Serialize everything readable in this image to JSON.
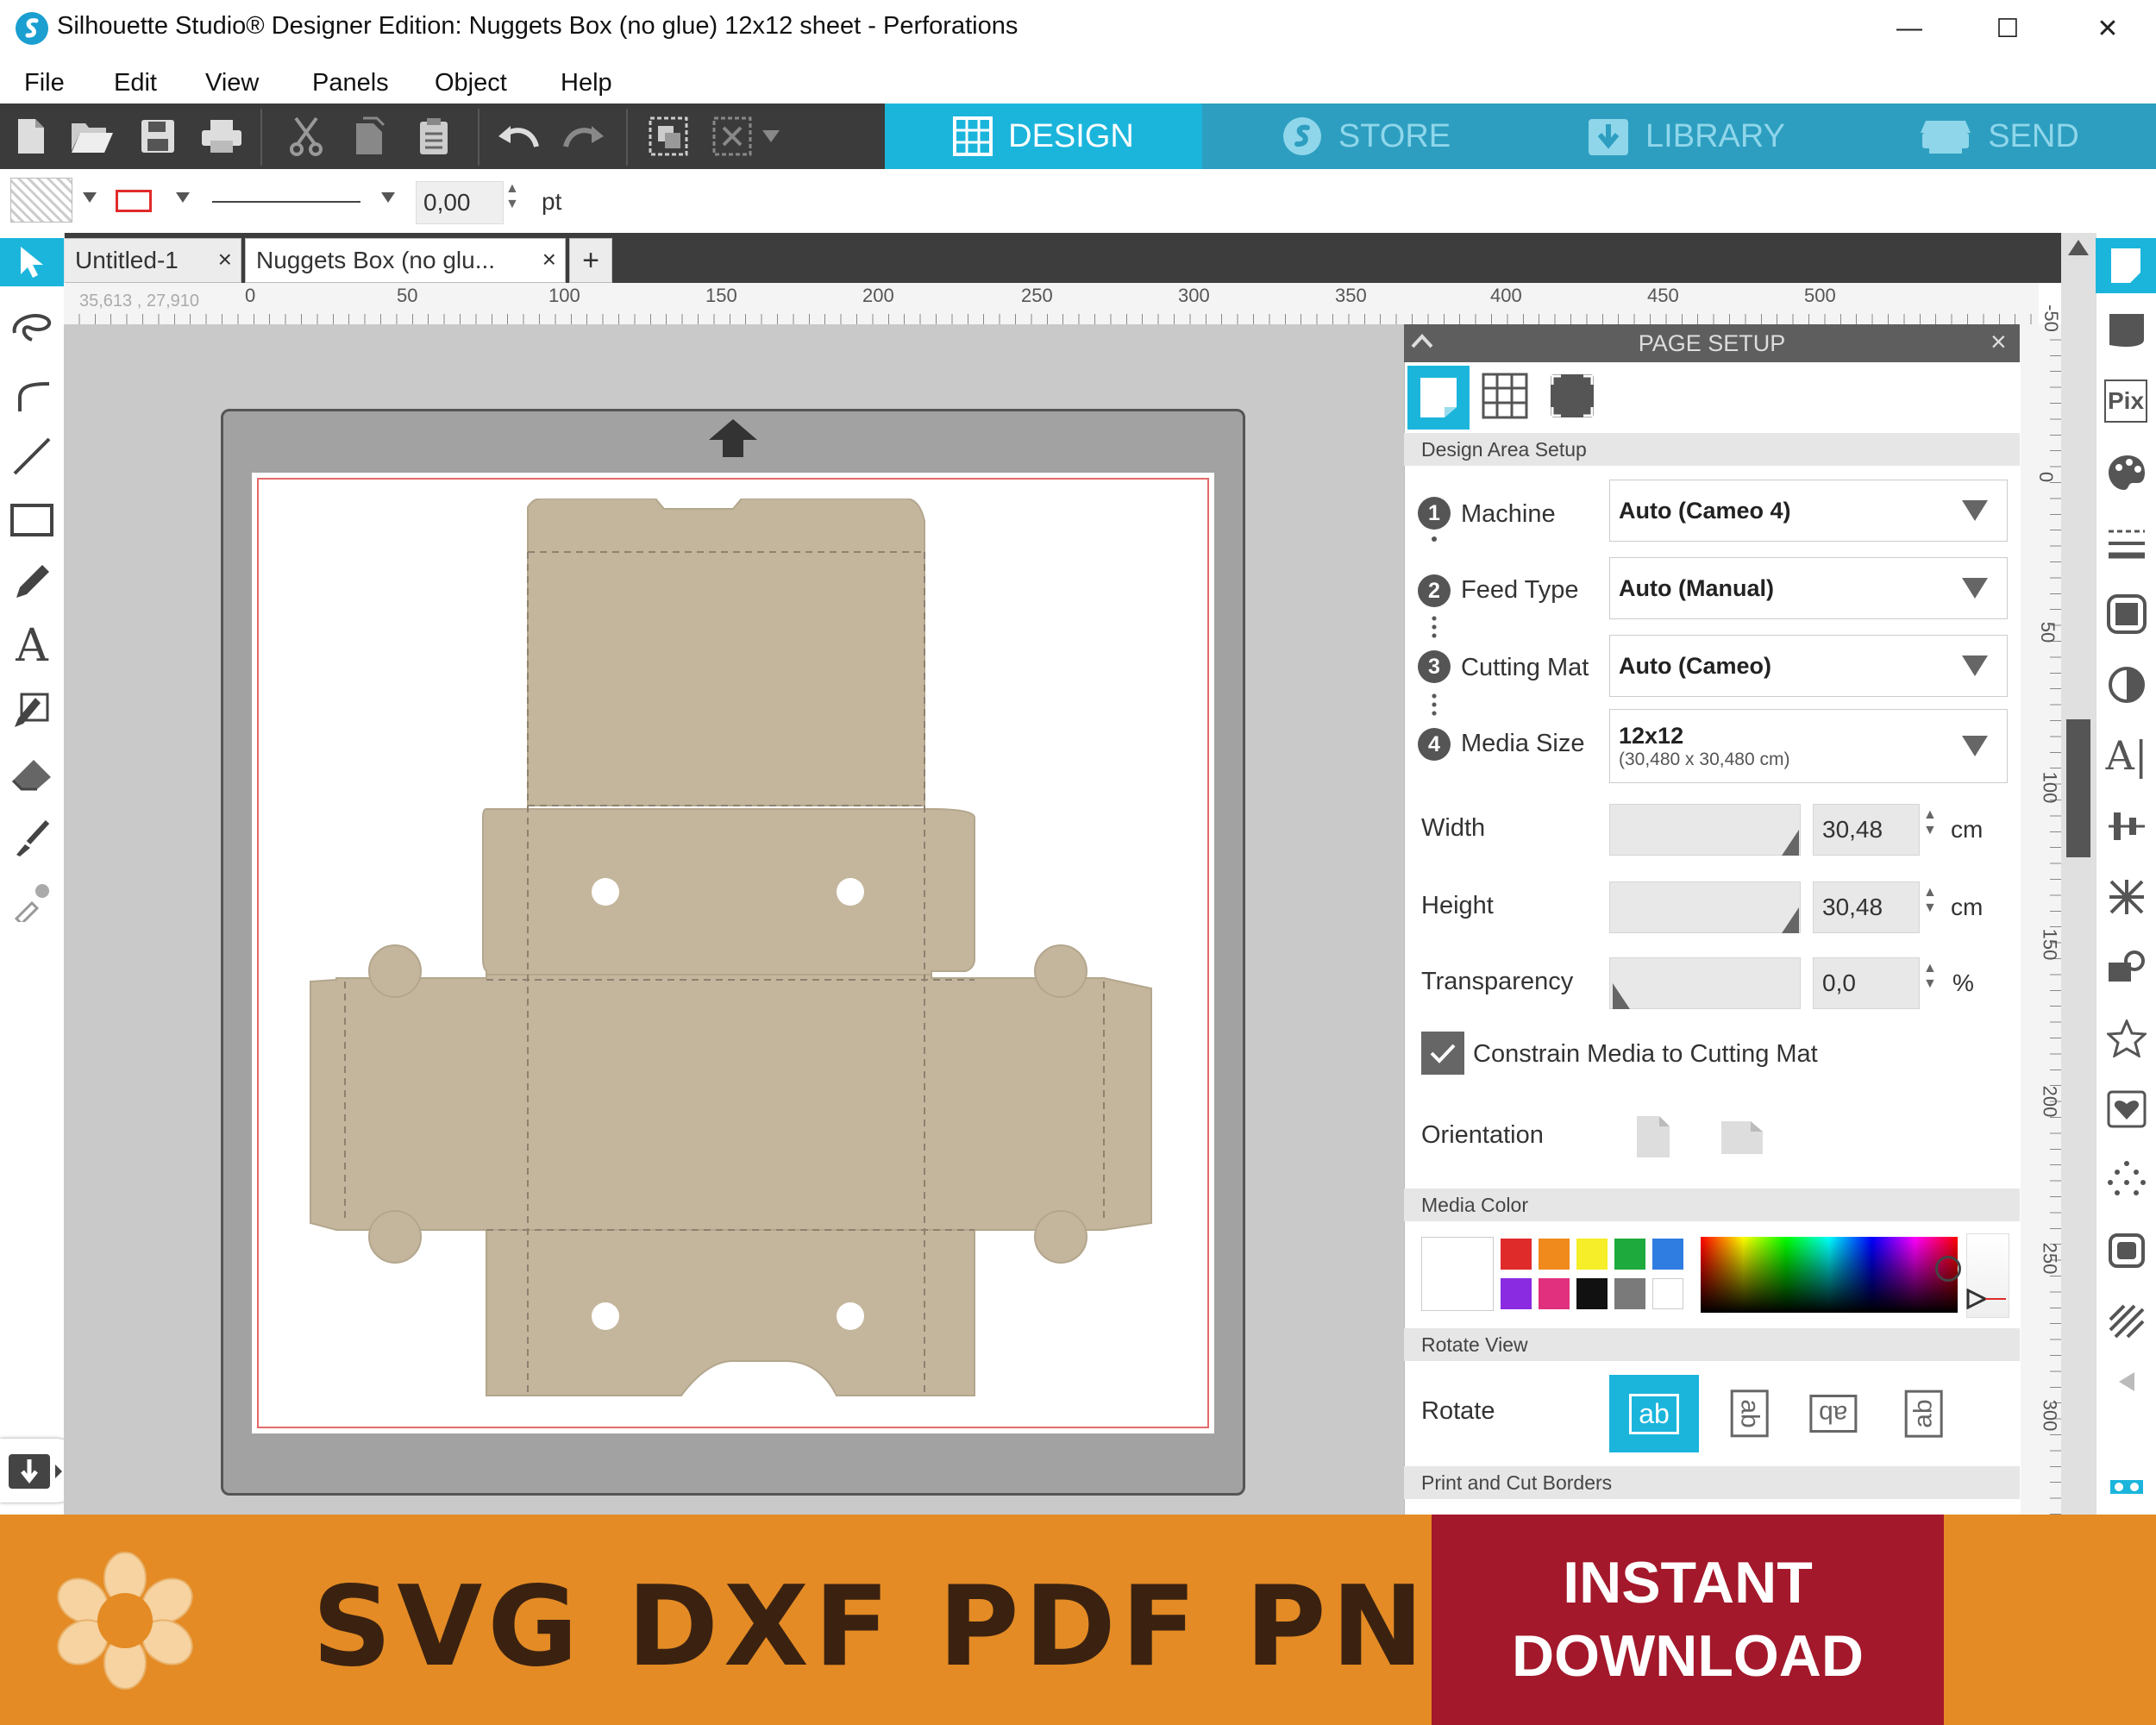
{
  "window": {
    "title": "Silhouette Studio® Designer Edition: Nuggets Box (no glue) 12x12 sheet - Perforations",
    "minimize": "—",
    "maximize": "☐",
    "close": "✕"
  },
  "menu": [
    "File",
    "Edit",
    "View",
    "Panels",
    "Object",
    "Help"
  ],
  "nav_tabs": {
    "design": "DESIGN",
    "store": "STORE",
    "library": "LIBRARY",
    "send": "SEND"
  },
  "properties": {
    "line_width": "0,00",
    "unit": "pt"
  },
  "doc_tabs": [
    {
      "label": "Untitled-1",
      "close": "×"
    },
    {
      "label": "Nuggets Box (no glu...",
      "close": "×"
    }
  ],
  "add_tab": "+",
  "cursor_coords": "35,613 , 27,910",
  "ruler_h": [
    "0",
    "50",
    "100",
    "150",
    "200",
    "250",
    "300",
    "350",
    "400",
    "450",
    "500"
  ],
  "ruler_v": [
    "-50",
    "0",
    "50",
    "100",
    "150",
    "200",
    "250",
    "300"
  ],
  "page_setup": {
    "title": "PAGE SETUP",
    "close": "×",
    "section_design_area": "Design Area Setup",
    "machine": {
      "num": "1",
      "label": "Machine",
      "value": "Auto (Cameo 4)"
    },
    "feed_type": {
      "num": "2",
      "label": "Feed Type",
      "value": "Auto (Manual)"
    },
    "cutting_mat": {
      "num": "3",
      "label": "Cutting Mat",
      "value": "Auto (Cameo)"
    },
    "media_size": {
      "num": "4",
      "label": "Media Size",
      "value": "12x12",
      "subvalue": "(30,480 x 30,480 cm)"
    },
    "width": {
      "label": "Width",
      "value": "30,48",
      "unit": "cm"
    },
    "height": {
      "label": "Height",
      "value": "30,48",
      "unit": "cm"
    },
    "transparency": {
      "label": "Transparency",
      "value": "0,0",
      "unit": "%"
    },
    "constrain_label": "Constrain Media to Cutting Mat",
    "constrain_checked": true,
    "orientation_label": "Orientation",
    "section_media_color": "Media Color",
    "swatches": [
      "#e02b2b",
      "#f08a1c",
      "#f5ee28",
      "#1eaa3c",
      "#2f7de0",
      "#8a2be2",
      "#e0307e",
      "#111111",
      "#7a7a7a",
      "#ffffff"
    ],
    "section_rotate_view": "Rotate View",
    "rotate_label": "Rotate",
    "rotate_glyph": "ab",
    "section_print_cut": "Print and Cut Borders"
  },
  "banner": {
    "formats": "SVG DXF PDF PNG",
    "instant_line1": "INSTANT",
    "instant_line2": "DOWNLOAD"
  },
  "colors": {
    "accent": "#1bb5dc",
    "toolbar": "#3b3b3b",
    "box_fill": "#c4b69c",
    "banner": "#e48b25",
    "download": "#a3182b"
  }
}
